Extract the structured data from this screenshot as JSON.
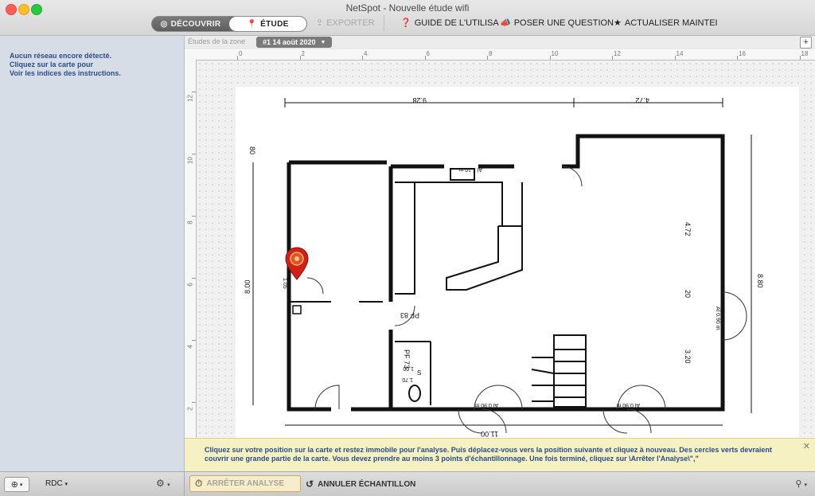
{
  "window": {
    "title": "NetSpot - Nouvelle étude wifi"
  },
  "toolbar": {
    "discover_label": "DÉCOUVRIR",
    "survey_label": "ÉTUDE",
    "export_label": "EXPORTER",
    "guide_label": "GUIDE DE L'UTILISA",
    "question_label": "POSER UNE QUESTION",
    "update_label": "ACTUALISER MAINTEI"
  },
  "sidebar": {
    "message": [
      "Aucun réseau encore détecté.",
      "Cliquez sur la carte pour",
      "Voir les indices des instructions."
    ]
  },
  "zone": {
    "label": "Études de la zone",
    "selected": "#1 14 août 2020"
  },
  "rulers": {
    "top": [
      "0",
      "2",
      "4",
      "6",
      "8",
      "10",
      "12",
      "14",
      "16",
      "18"
    ],
    "left": [
      "12",
      "10",
      "8",
      "6",
      "4",
      "2"
    ]
  },
  "plan_labels": {
    "dim_top_left": "9.28",
    "dim_top_right": "4.72",
    "dim_left": "8.00",
    "dim_right": "8.80",
    "dim_bottom": "11.00",
    "dim_inner_472": "4.72",
    "dim_inner_20": "20",
    "dim_inner_320": "3.20",
    "pf83": "PF 83",
    "pf73": "PF 73",
    "window_110": "Al 1.10 m",
    "window_090a": "Al 0.90 m",
    "window_090b": "Al 0.90 m",
    "window_090c": "Al 0.90 m",
    "wc_label": "S",
    "wc_170": "1.70",
    "wc_100": "1.00",
    "label_80": "80",
    "door_105": "1.05"
  },
  "hint": {
    "text": "Cliquez sur votre position sur la carte et restez immobile pour l'analyse. Puis déplacez-vous vers la position suivante et cliquez à nouveau. Des cercles verts devraient couvrir une grande partie de la carte. Vous devez prendre au moins 3 points d'échantillonnage. Une fois terminé, cliquez sur \\Arrêter l'Analyse\\\",\""
  },
  "bottom": {
    "floor": "RDC",
    "stop_label": "ARRÊTER ANALYSE",
    "cancel_label": "ANNULER ÉCHANTILLON"
  },
  "colors": {
    "pin": "#d0201a",
    "hint_bg": "#f5f1c3",
    "sidebar_bg": "#d6dde7",
    "text_blue": "#2b4d8a"
  }
}
